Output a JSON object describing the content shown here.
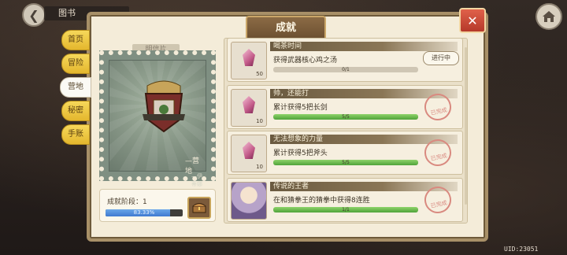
{
  "header": {
    "title": "图书",
    "close_glyph": "✕",
    "back_glyph": "❮"
  },
  "panel": {
    "title": "成就"
  },
  "side_tabs": [
    "首页",
    "冒险",
    "营地",
    "秘密",
    "手账"
  ],
  "active_tab": 2,
  "stamp": {
    "header": "明信片",
    "label": "—营地",
    "sub": "—伊蒂娜"
  },
  "stage": {
    "label": "成就阶段：1",
    "progress_text": "83.33%",
    "progress": 0.8333
  },
  "rows": [
    {
      "title": "喝茶时间",
      "desc": "获得武器核心鸡之汤",
      "qty": "50",
      "progress_text": "0/1",
      "progress": 0,
      "status": "进行中",
      "done": false,
      "icon": "pink-gem-icon"
    },
    {
      "title": "帅，还能打",
      "desc": "累计获得5把长剑",
      "qty": "10",
      "progress_text": "5/5",
      "progress": 1,
      "status": "已完成",
      "done": true,
      "icon": "pink-gem-icon"
    },
    {
      "title": "无法想象的力量",
      "desc": "累计获得5把斧头",
      "qty": "10",
      "progress_text": "5/5",
      "progress": 1,
      "status": "已完成",
      "done": true,
      "icon": "pink-gem-icon"
    },
    {
      "title": "传说的王者",
      "desc": "在和猜拳王的猜拳中获得8连胜",
      "qty": "",
      "progress_text": "1/1",
      "progress": 1,
      "status": "已完成",
      "done": true,
      "icon": "character-portrait"
    }
  ],
  "footer": {
    "uid": "UID:23051"
  },
  "colors": {
    "tab_yellow": "#f6d85a",
    "progress_green": "#4fa33a",
    "progress_blue": "#3f7ad0",
    "close_red": "#b5392a"
  }
}
